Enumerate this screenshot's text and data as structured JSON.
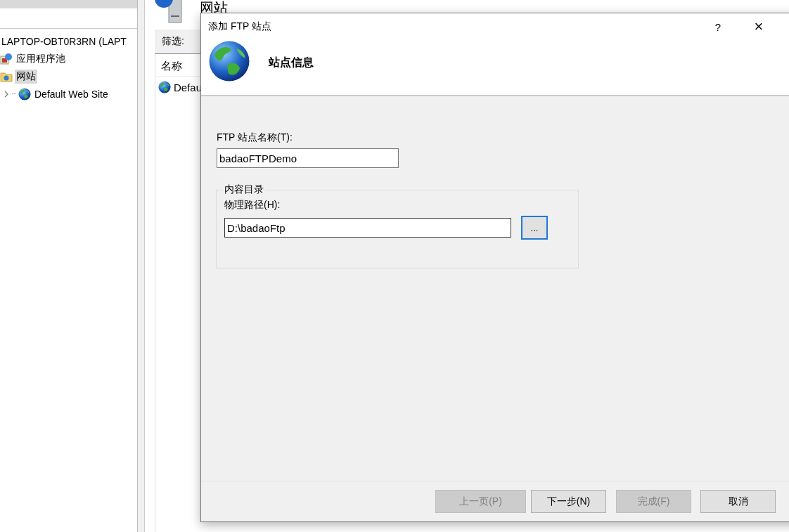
{
  "manager": {
    "tree": [
      {
        "label": "LAPTOP-OBT0R3RN (LAPT",
        "selected": false,
        "children": [
          {
            "kind": "pool",
            "label": "应用程序池",
            "selected": false
          },
          {
            "kind": "sites",
            "label": "网站",
            "selected": true,
            "children": [
              {
                "kind": "site",
                "label": "Default Web Site",
                "selected": false,
                "expanded": false
              }
            ]
          }
        ]
      }
    ],
    "pane_title": "网站",
    "filter_label": "筛选:",
    "column": "名称",
    "rows": [
      "Defau"
    ]
  },
  "dialog": {
    "title": "添加 FTP 站点",
    "help": "?",
    "close": "×",
    "heading": "站点信息",
    "name_label": "FTP 站点名称(T):",
    "name_value": "badaoFTPDemo",
    "group_title": "内容目录",
    "path_label": "物理路径(H):",
    "path_value": "D:\\badaoFtp",
    "browse": "...",
    "buttons": [
      {
        "label": "上一页(P)",
        "disabled": true,
        "focused": false
      },
      {
        "label": "下一步(N)",
        "disabled": false,
        "focused": false
      },
      {
        "label": "完成(F)",
        "disabled": true,
        "focused": false
      },
      {
        "label": "取消",
        "disabled": false,
        "focused": false
      }
    ]
  }
}
